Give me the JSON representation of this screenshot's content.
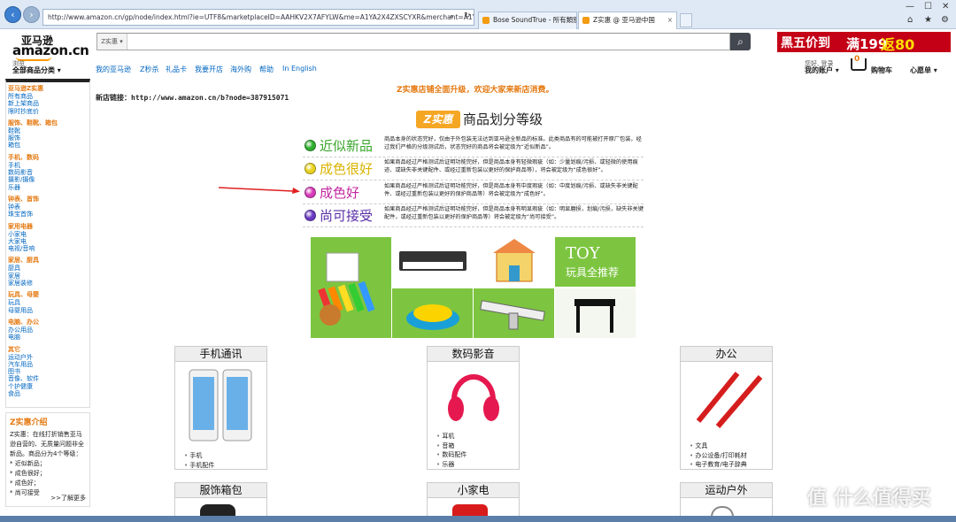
{
  "browser": {
    "url": "http://www.amazon.cn/gp/node/index.html?ie=UTF8&marketplaceID=AAHKV2X7AFYLW&me=A1YA2X4ZXSCYXR&merchant=A1YA2X4ZXSC",
    "tabs": [
      {
        "label": "Bose SoundTrue - 所有類別 ..."
      },
      {
        "label": "Z实惠 @ 亚马逊中国"
      }
    ]
  },
  "header": {
    "logo_cn": "亚马逊",
    "logo_en": "amazon.cn",
    "search_category": "Z实惠",
    "promo": {
      "part1": "黑五价到",
      "part2": "满199",
      "part3": "返80"
    },
    "browse_small": "浏览",
    "browse_main": "全部商品分类",
    "nav": [
      "我的亚马逊",
      "Z秒杀",
      "礼品卡",
      "我要开店",
      "海外购",
      "帮助",
      "In English"
    ],
    "account_small": "您好, 登录",
    "account_main": "我的账户",
    "cart_count": "0",
    "cart_label": "购物车",
    "wishlist": "心愿单"
  },
  "sidebar": {
    "groups": [
      {
        "head": "亚马逊Z实惠",
        "items": [
          "所有商品",
          "新上架商品",
          "限时抄底价"
        ]
      },
      {
        "head": "服饰、鞋靴、箱包",
        "items": [
          "鞋靴",
          "服饰",
          "箱包"
        ]
      },
      {
        "head": "手机、数码",
        "items": [
          "手机",
          "数码影音",
          "摄影/摄像",
          "乐器"
        ]
      },
      {
        "head": "钟表、首饰",
        "items": [
          "钟表",
          "珠宝首饰"
        ]
      },
      {
        "head": "家用电器",
        "items": [
          "小家电",
          "大家电",
          "电视/音响"
        ]
      },
      {
        "head": "家居、厨具",
        "items": [
          "厨具",
          "家居",
          "家居装修"
        ]
      },
      {
        "head": "玩具、母婴",
        "items": [
          "玩具",
          "母婴用品"
        ]
      },
      {
        "head": "电脑、办公",
        "items": [
          "办公用品",
          "电脑"
        ]
      },
      {
        "head": "其它",
        "items": [
          "运动户外",
          "汽车用品",
          "图书",
          "音像、软件",
          "个护健康",
          "食品"
        ]
      }
    ]
  },
  "intro": {
    "title": "Z实惠介绍",
    "text": "Z实惠：在线打折销售亚马逊自营的、无质量问题非全新品。商品分为4个等级：",
    "levels": [
      "* 近似新品；",
      "* 成色很好；",
      "* 成色好；",
      "* 尚可接受"
    ],
    "more": ">>了解更多"
  },
  "main": {
    "notice": "Z实惠店铺全面升级，欢迎大家来新店消费。",
    "new_link": "新店链接：http://www.amazon.cn/b?node=387915071",
    "z_logo": "Z实惠",
    "grade_title": "商品划分等级",
    "grades": [
      {
        "label": "近似新品",
        "color": "#2eae2e",
        "label_color": "#3aa52c",
        "desc": "商品本身的状态完好，仅由于外包装无法达到亚马逊全新品的标准。此类商品有的可能被打开原厂包装，经过我们严格的分级测试后，状态完好的商品将会被定级为“近似新品”。"
      },
      {
        "label": "成色很好",
        "color": "#e8d21d",
        "label_color": "#d9b400",
        "desc": "如果商品经过严格测试后证明功能完好，但是商品本身有轻微瑕疵（如：少量划痕/污损、或轻微的使用痕迹、或缺失非关键配件、或经过重新包装以更好的保护商品等），将会被定级为“成色很好”。"
      },
      {
        "label": "成色好",
        "color": "#d63ab8",
        "label_color": "#c3299f",
        "desc": "如果商品经过严格测试后证明功能完好，但是商品本身有中度瑕疵（如：中度划痕/污损、或缺失非关键配件、或经过重新包装以更好的保护商品等）将会被定级为“成色好”。"
      },
      {
        "label": "尚可接受",
        "color": "#6a3ac2",
        "label_color": "#5a2fa8",
        "desc": "如果商品经过严格测试后证明功能完好，但是商品本身有明显瑕疵（如：明显磨损，划痕/污损，缺失非关键配件，或经过重新包装以更好的保护商品等）将会被定级为“尚可接受”。"
      }
    ],
    "toy_banner": {
      "en": "TOY",
      "cn": "玩具全推荐"
    },
    "categories": [
      {
        "title": "手机通讯",
        "items": [
          "手机",
          "手机配件"
        ]
      },
      {
        "title": "数码影音",
        "items": [
          "耳机",
          "音箱",
          "数码配件",
          "乐器"
        ]
      },
      {
        "title": "办公",
        "items": [
          "文具",
          "办公设备/打印耗材",
          "电子教育/电子辞典"
        ]
      }
    ],
    "categories_row2": [
      {
        "title": "服饰箱包"
      },
      {
        "title": "小家电"
      },
      {
        "title": "运动户外"
      }
    ]
  },
  "watermark": "值 什么值得买"
}
